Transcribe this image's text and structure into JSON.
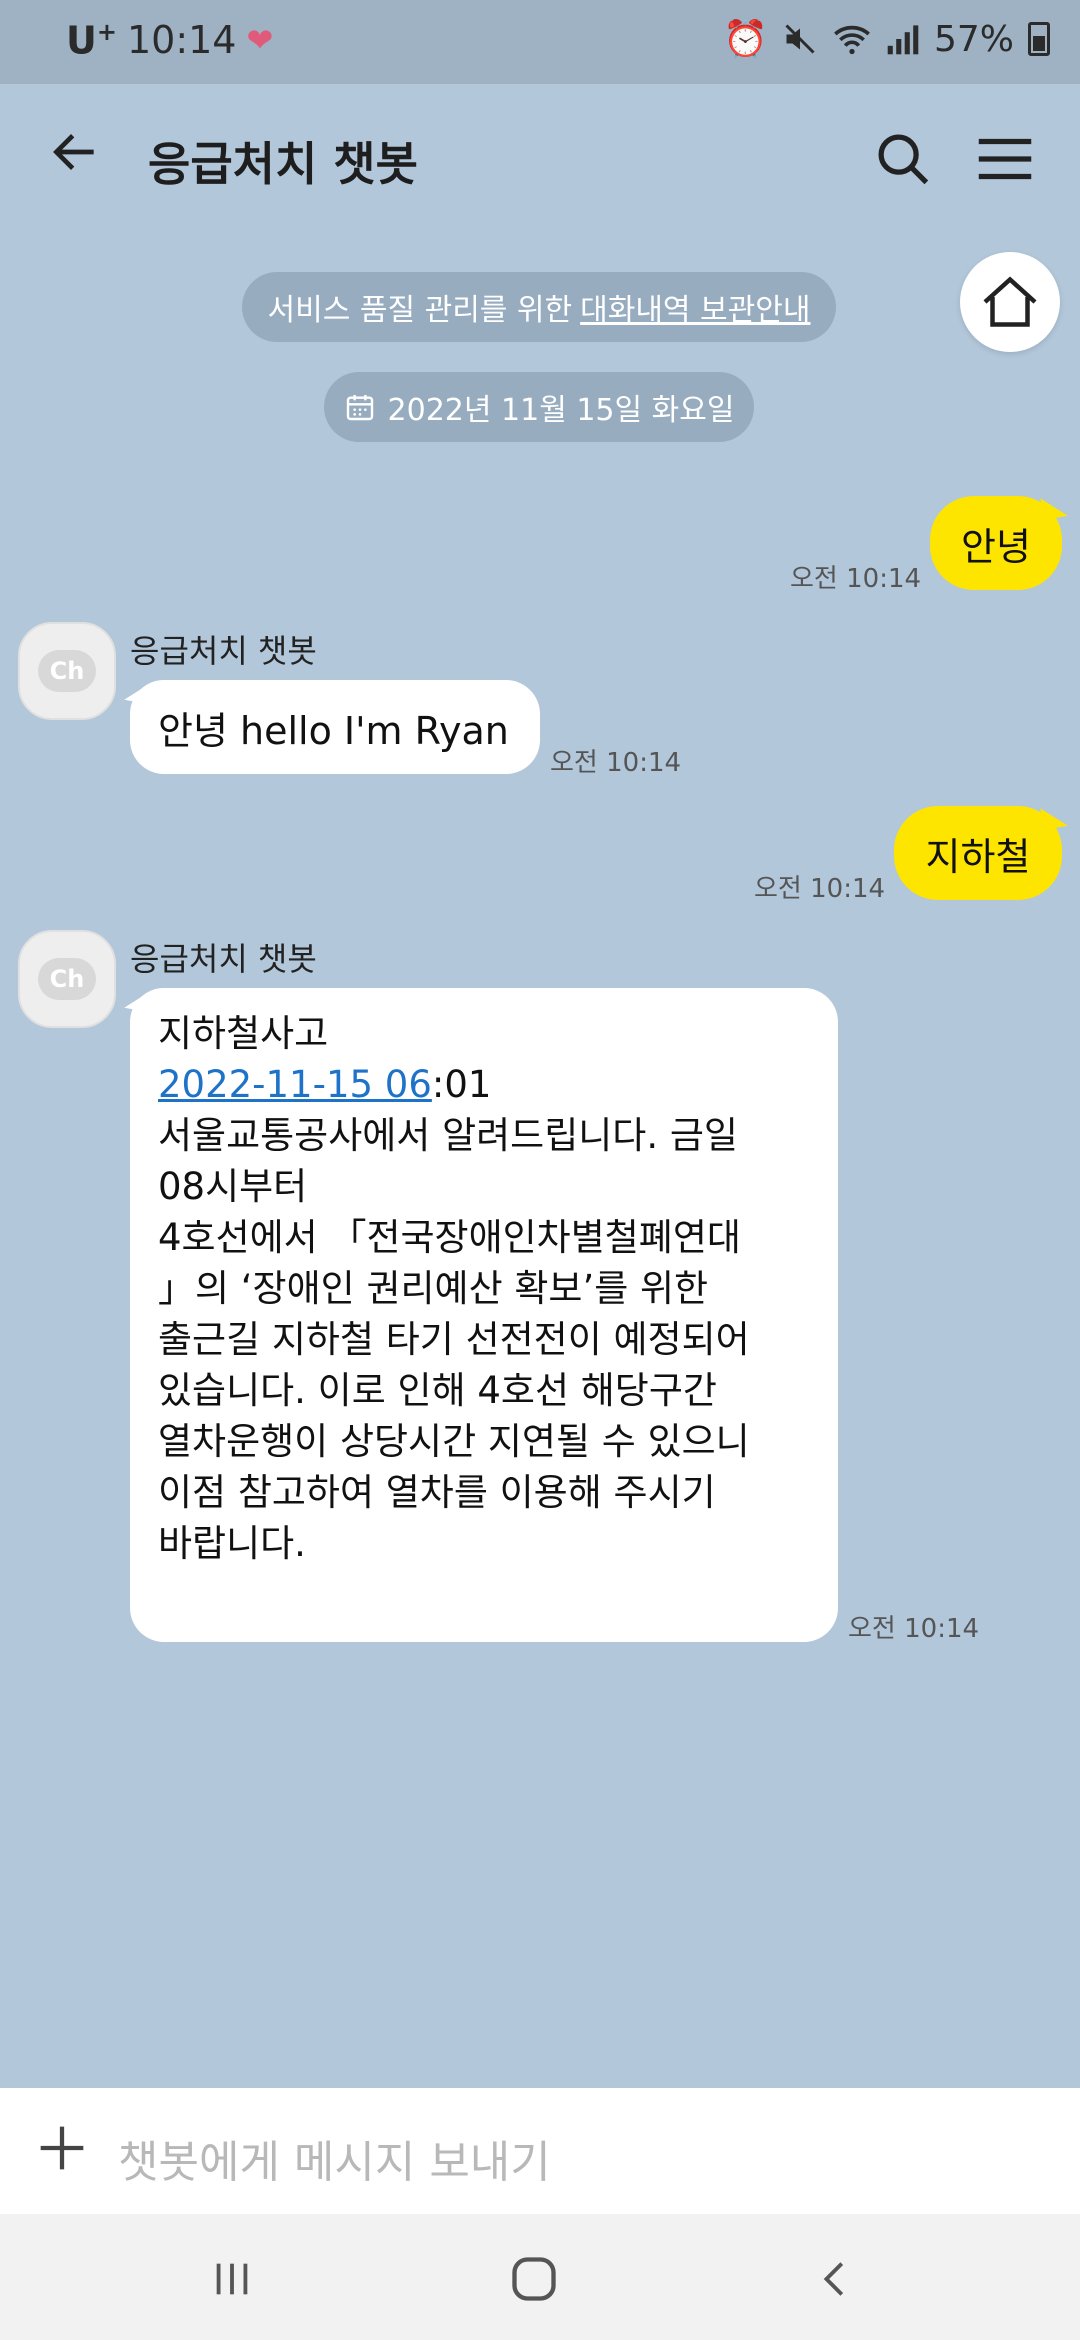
{
  "status_bar": {
    "carrier": "U",
    "carrier_sup": "+",
    "time": "10:14",
    "battery": "57%"
  },
  "header": {
    "title": "응급처치 챗봇"
  },
  "notice": {
    "text": "서비스 품질 관리를 위한",
    "link": "대화내역 보관안내"
  },
  "date_divider": "2022년 11월 15일 화요일",
  "messages": [
    {
      "from": "me",
      "text": "안녕",
      "time": "오전 10:14"
    },
    {
      "from": "bot",
      "sender": "응급처치 챗봇",
      "text": "안녕 hello I'm Ryan",
      "time": "오전 10:14"
    },
    {
      "from": "me",
      "text": "지하철",
      "time": "오전 10:14"
    },
    {
      "from": "bot",
      "sender": "응급처치 챗봇",
      "line1": "지하철사고",
      "link": "2022-11-15 06",
      "link_suffix": ":01",
      "body": "서울교통공사에서 알려드립니다. 금일\n08시부터\n4호선에서 「전국장애인차별철폐연대\n」의 ‘장애인 권리예산 확보’를 위한\n출근길 지하철 타기 선전전이 예정되어\n있습니다. 이로 인해 4호선 해당구간\n열차운행이 상당시간 지연될 수 있으니\n이점 참고하여 열차를 이용해 주시기\n바랍니다.",
      "time": "오전 10:14"
    }
  ],
  "avatar_label": "Ch",
  "composer": {
    "placeholder": "챗봇에게 메시지 보내기"
  },
  "colors": {
    "background": "#b2c7da",
    "my_bubble": "#fee500",
    "bot_bubble": "#ffffff",
    "link": "#1e73c8"
  }
}
